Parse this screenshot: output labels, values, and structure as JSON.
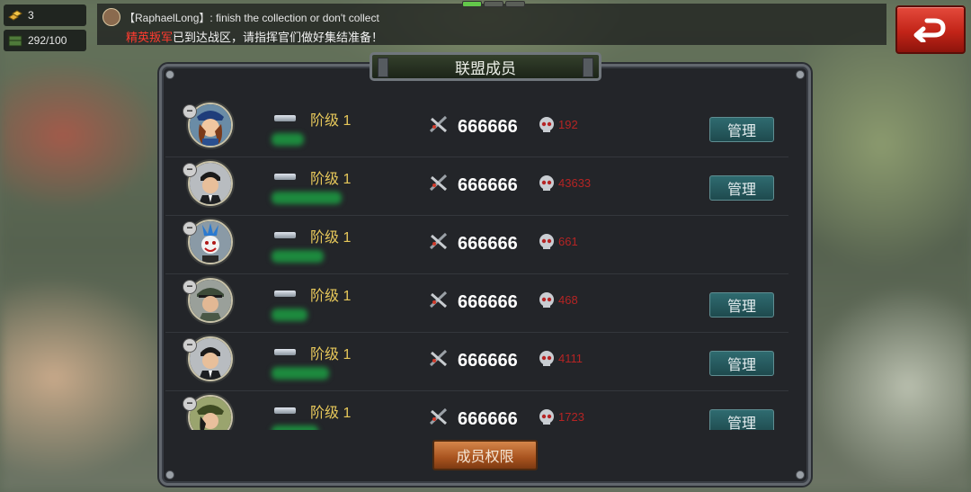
{
  "resources": {
    "gold": "3",
    "supply": "292/100"
  },
  "chat": {
    "sender_line": "【RaphaelLong】: finish the collection or don't collect",
    "system_red": "精英叛军",
    "system_msg": "已到达战区，请指挥官们做好集结准备！"
  },
  "panel": {
    "title": "联盟成员",
    "footer_button": "成员权限"
  },
  "members": [
    {
      "portrait": "policewoman",
      "rank": "阶级 1",
      "power": "666666",
      "kills": "192",
      "manage": "管理"
    },
    {
      "portrait": "agent",
      "rank": "阶级 1",
      "power": "666666",
      "kills": "43633",
      "manage": "管理"
    },
    {
      "portrait": "clown",
      "rank": "阶级 1",
      "power": "666666",
      "kills": "661",
      "manage": ""
    },
    {
      "portrait": "officer",
      "rank": "阶级 1",
      "power": "666666",
      "kills": "468",
      "manage": "管理"
    },
    {
      "portrait": "agent",
      "rank": "阶级 1",
      "power": "666666",
      "kills": "4111",
      "manage": "管理"
    },
    {
      "portrait": "soldier-woman",
      "rank": "阶级 1",
      "power": "666666",
      "kills": "1723",
      "manage": "管理"
    }
  ],
  "colors": {
    "rank": "#e6c75a",
    "kills": "#b52424",
    "manage_bg": "#2f6b70",
    "footer_bg": "#b35c24",
    "back_bg": "#d03426"
  }
}
